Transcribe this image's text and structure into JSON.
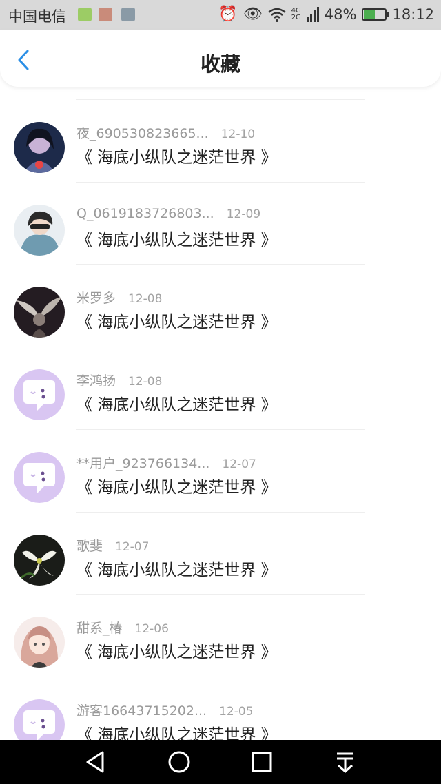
{
  "status": {
    "carrier": "中国电信",
    "network": [
      "4G",
      "2G"
    ],
    "battery": "48%",
    "battery_level": 0.48,
    "time": "18:12"
  },
  "header": {
    "title": "收藏"
  },
  "items": [
    {
      "user": "夜_690530823665...",
      "date": "12-10",
      "subject": "《 海底小纵队之迷茫世界 》",
      "avatar": "photo-girl-avatar"
    },
    {
      "user": "Q_0619183726803...",
      "date": "12-09",
      "subject": "《 海底小纵队之迷茫世界 》",
      "avatar": "photo-boy-avatar"
    },
    {
      "user": "米罗多",
      "date": "12-08",
      "subject": "《 海底小纵队之迷茫世界 》",
      "avatar": "photo-wings-avatar"
    },
    {
      "user": "李鸿扬",
      "date": "12-08",
      "subject": "《 海底小纵队之迷茫世界 》",
      "avatar": "default-chat-avatar"
    },
    {
      "user": "**用户_923766134...",
      "date": "12-07",
      "subject": "《 海底小纵队之迷茫世界 》",
      "avatar": "default-chat-avatar"
    },
    {
      "user": "歌斐",
      "date": "12-07",
      "subject": "《 海底小纵队之迷茫世界 》",
      "avatar": "photo-flower-avatar"
    },
    {
      "user": "甜系_椿",
      "date": "12-06",
      "subject": "《 海底小纵队之迷茫世界 》",
      "avatar": "anime-girl-avatar"
    },
    {
      "user": "游客16643715202...",
      "date": "12-05",
      "subject": "《 海底小纵队之迷茫世界 》",
      "avatar": "default-chat-avatar"
    }
  ],
  "colors": {
    "accent": "#2b8fe6",
    "default_avatar": "#d9c6f2",
    "text_primary": "#222222",
    "text_secondary": "#9a9a9a"
  }
}
